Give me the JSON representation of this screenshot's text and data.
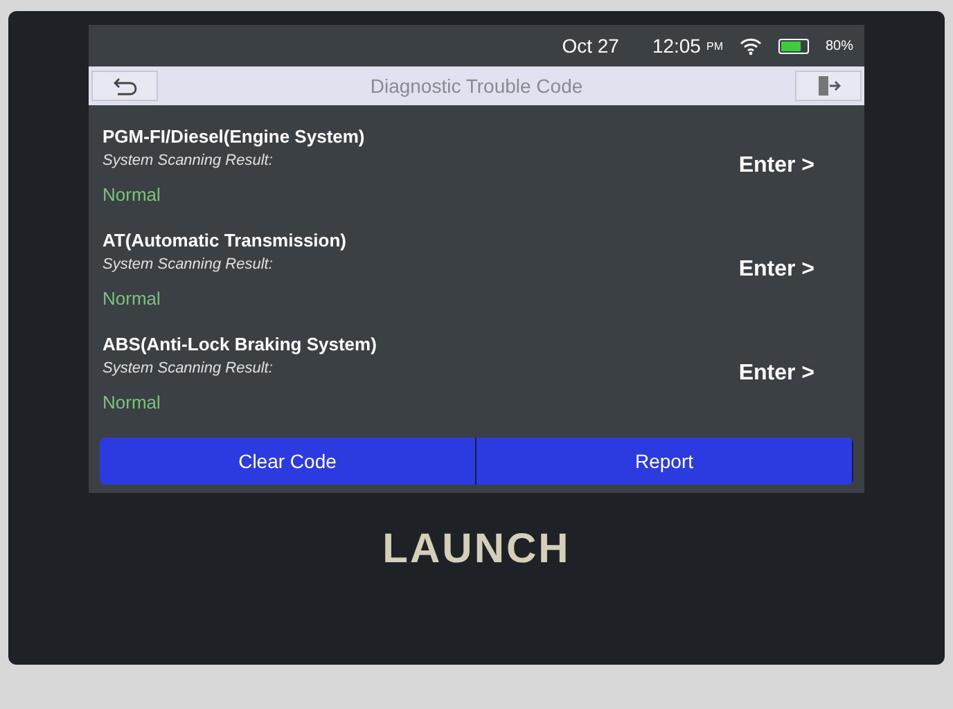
{
  "status_bar": {
    "date": "Oct 27",
    "time": "12:05",
    "ampm": "PM",
    "battery": {
      "text": "80%",
      "level": 0.8
    }
  },
  "header": {
    "title": "Diagnostic Trouble Code"
  },
  "systems": [
    {
      "name": "PGM-FI/Diesel(Engine System)",
      "result_label": "System Scanning Result:",
      "result": "Normal",
      "action": "Enter >"
    },
    {
      "name": "AT(Automatic Transmission)",
      "result_label": "System Scanning Result:",
      "result": "Normal",
      "action": "Enter >"
    },
    {
      "name": "ABS(Anti-Lock Braking System)",
      "result_label": "System Scanning Result:",
      "result": "Normal",
      "action": "Enter >"
    }
  ],
  "buttons": [
    "Clear Code",
    "Report"
  ],
  "device": {
    "brand": "LAUNCH"
  }
}
